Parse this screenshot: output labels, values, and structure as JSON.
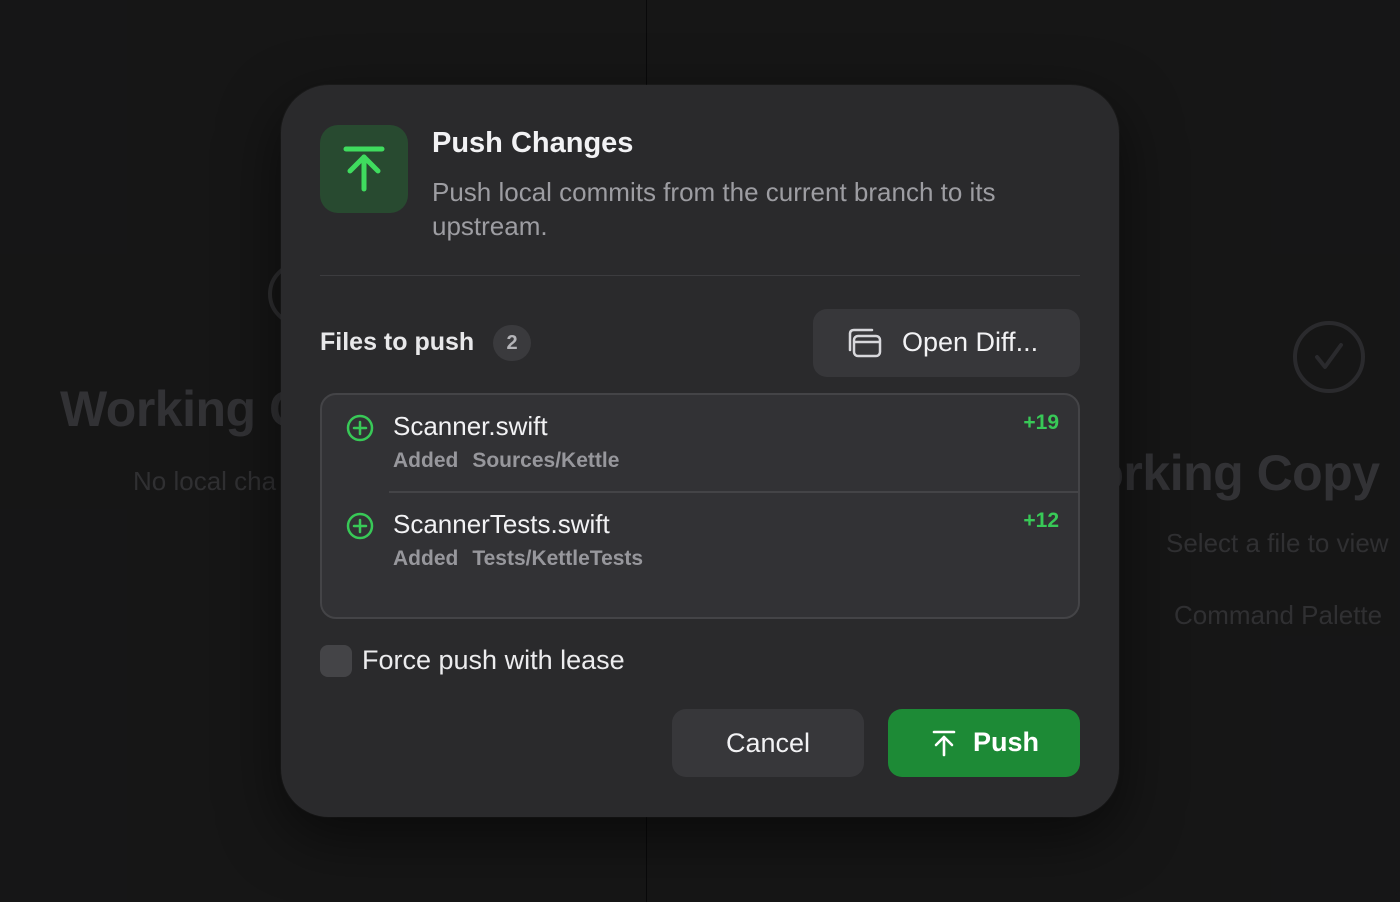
{
  "background": {
    "left_pane": {
      "title": "Working C",
      "subtitle": "No local cha"
    },
    "right_pane": {
      "title": "/orking Copy",
      "subtitle": "Select a file to view",
      "command_palette": "Command Palette"
    }
  },
  "dialog": {
    "icon": "arrow-up-to-line-icon",
    "title": "Push Changes",
    "subtitle": "Push local commits from the current branch to its upstream.",
    "files_label": "Files to push",
    "files_count": "2",
    "open_diff_label": "Open Diff...",
    "files": [
      {
        "name": "Scanner.swift",
        "status": "Added",
        "path": "Sources/Kettle",
        "delta": "+19"
      },
      {
        "name": "ScannerTests.swift",
        "status": "Added",
        "path": "Tests/KettleTests",
        "delta": "+12"
      }
    ],
    "force_push_label": "Force push with lease",
    "force_push_checked": false,
    "cancel_label": "Cancel",
    "push_label": "Push"
  },
  "colors": {
    "accent_green": "#1d8a36",
    "added_green": "#38c957",
    "dialog_bg": "#2a2a2c"
  }
}
